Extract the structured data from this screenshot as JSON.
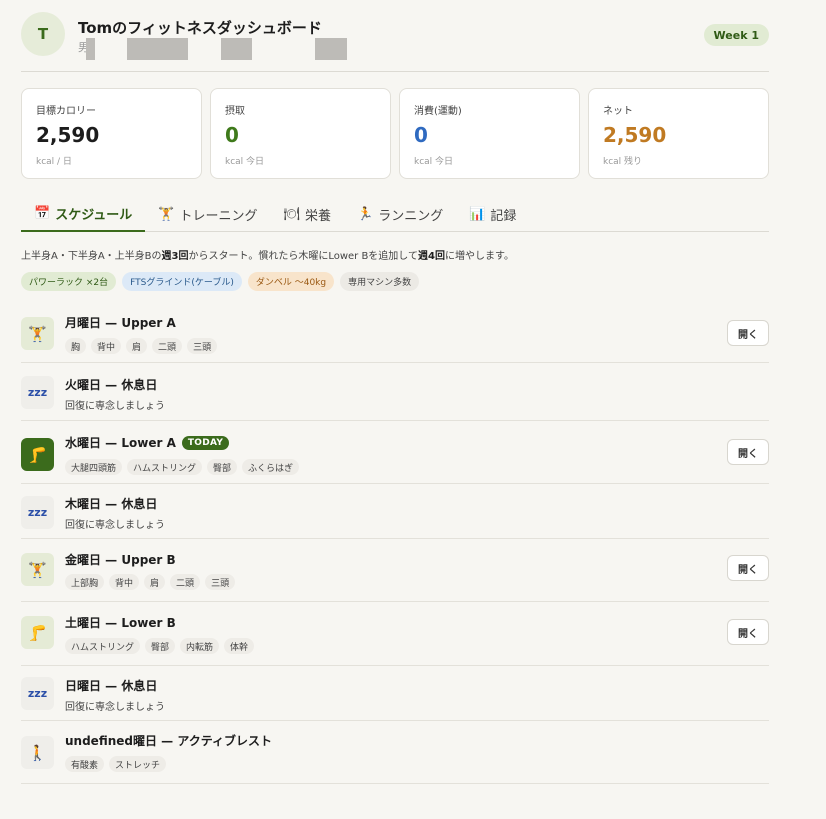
{
  "header": {
    "avatar_letter": "T",
    "title": "Tomのフィットネスダッシュボード",
    "subtitle": "男",
    "week_badge": "Week 1"
  },
  "stats": [
    {
      "label": "目標カロリー",
      "value": "2,590",
      "unit": "kcal / 日",
      "color": "#1d1d1d"
    },
    {
      "label": "摂取",
      "value": "0",
      "unit": "kcal 今日",
      "color": "#3f7a1b"
    },
    {
      "label": "消費(運動)",
      "value": "0",
      "unit": "kcal 今日",
      "color": "#2f6ac0"
    },
    {
      "label": "ネット",
      "value": "2,590",
      "unit": "kcal 残り",
      "color": "#c07a22"
    }
  ],
  "tabs": [
    {
      "icon": "📅",
      "icon_name": "calendar-icon",
      "label": "スケジュール",
      "active": true
    },
    {
      "icon": "🏋",
      "icon_name": "weightlifter-icon",
      "label": "トレーニング",
      "active": false
    },
    {
      "icon": "🍽",
      "icon_name": "plate-icon",
      "label": "栄養",
      "active": false
    },
    {
      "icon": "🏃",
      "icon_name": "runner-icon",
      "label": "ランニング",
      "active": false
    },
    {
      "icon": "📊",
      "icon_name": "bar-chart-icon",
      "label": "記録",
      "active": false
    }
  ],
  "intro": {
    "part1": "上半身A・下半身A・上半身Bの",
    "bold1": "週3回",
    "part2": "からスタート。慣れたら木曜にLower Bを追加して",
    "bold2": "週4回",
    "part3": "に増やします。"
  },
  "equipment": [
    "パワーラック ×2台",
    "FTSグラインド(ケーブル)",
    "ダンベル 〜40kg",
    "専用マシン多数"
  ],
  "schedule": {
    "open_label": "開く",
    "today_label": "TODAY",
    "days": [
      {
        "title": "月曜日 — Upper A",
        "icon": "🏋",
        "muscles": [
          "胸",
          "背中",
          "肩",
          "二頭",
          "三頭"
        ]
      },
      {
        "title": "火曜日 — 休息日",
        "icon": "zzz",
        "sub": "回復に専念しましょう"
      },
      {
        "title": "水曜日 — Lower A",
        "icon": "🦵",
        "muscles": [
          "大腿四頭筋",
          "ハムストリング",
          "臀部",
          "ふくらはぎ"
        ]
      },
      {
        "title": "木曜日 — 休息日",
        "icon": "zzz",
        "sub": "回復に専念しましょう"
      },
      {
        "title": "金曜日 — Upper B",
        "icon": "🏋",
        "muscles": [
          "上部胸",
          "背中",
          "肩",
          "二頭",
          "三頭"
        ]
      },
      {
        "title": "土曜日 — Lower B",
        "icon": "🦵",
        "muscles": [
          "ハムストリング",
          "臀部",
          "内転筋",
          "体幹"
        ]
      },
      {
        "title": "日曜日 — 休息日",
        "icon": "zzz",
        "sub": "回復に専念しましょう"
      },
      {
        "title": "undefined曜日 — アクティブレスト",
        "icon": "🚶",
        "muscles": [
          "有酸素",
          "ストレッチ"
        ]
      }
    ]
  }
}
